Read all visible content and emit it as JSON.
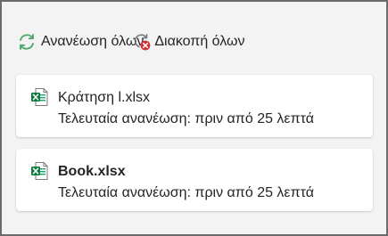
{
  "toolbar": {
    "refresh_all_label": "Ανανέωση όλων",
    "refresh_all_icon": "refresh-icon",
    "stop_all_label": "Διακοπή όλων",
    "stop_all_icon": "cancel-refresh-icon"
  },
  "files": [
    {
      "name": "Κράτηση l.xlsx",
      "status": "Τελευταία ανανέωση: πριν από 25 λεπτά",
      "icon": "excel-file-icon"
    },
    {
      "name": "Book.xlsx",
      "status": "Τελευταία ανανέωση: πριν από 25 λεπτά",
      "icon": "excel-file-icon"
    }
  ],
  "colors": {
    "refresh_green": "#4aa564",
    "stop_red": "#d13438",
    "excel_green": "#107c41"
  }
}
